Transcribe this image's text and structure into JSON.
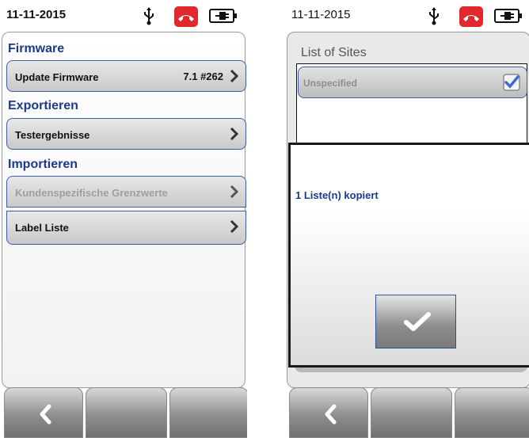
{
  "left_screen": {
    "status": {
      "date": "11-11-2015",
      "usb_icon": "usb-icon",
      "phone_icon": "phone-hangup-icon",
      "battery_icon": "battery-plug-icon"
    },
    "sections": {
      "firmware": {
        "title": "Firmware",
        "items": [
          {
            "label": "Update Firmware",
            "value": "7.1  #262"
          }
        ]
      },
      "export": {
        "title": "Exportieren",
        "items": [
          {
            "label": "Testergebnisse"
          }
        ]
      },
      "import": {
        "title": "Importieren",
        "items": [
          {
            "label": "Kundenspezifische Grenzwerte",
            "disabled": true
          },
          {
            "label": "Label Liste"
          }
        ]
      }
    },
    "footer": {
      "back_icon": "chevron-left-icon"
    }
  },
  "right_screen": {
    "status": {
      "date": "11-11-2015"
    },
    "list_title": "List of Sites",
    "sites": [
      {
        "label": "Unspecified",
        "checked": true
      }
    ],
    "dialog": {
      "message": "1 Liste(n) kopiert",
      "ok_icon": "checkmark-icon"
    },
    "footer": {
      "back_icon": "chevron-left-icon"
    }
  },
  "colors": {
    "accent_blue": "#1c3a8c",
    "border_blue": "#3a5da8",
    "phone_red": "#e0282e"
  }
}
